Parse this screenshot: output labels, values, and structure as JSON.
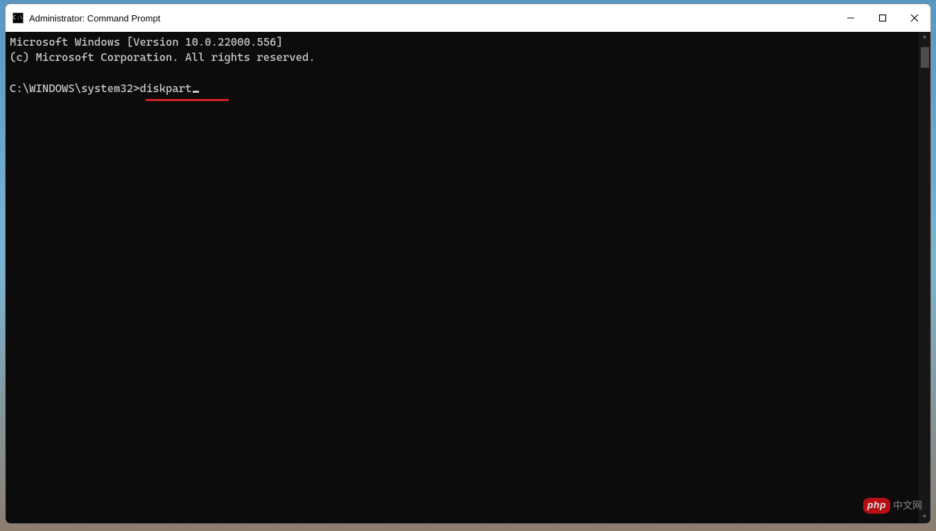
{
  "window": {
    "title": "Administrator: Command Prompt",
    "icon_label": "cmd-icon"
  },
  "controls": {
    "minimize_label": "Minimize",
    "maximize_label": "Maximize",
    "close_label": "Close"
  },
  "console": {
    "line1": "Microsoft Windows [Version 10.0.22000.556]",
    "line2": "(c) Microsoft Corporation. All rights reserved.",
    "blank": "",
    "prompt": "C:\\WINDOWS\\system32>",
    "command": "diskpart"
  },
  "annotation": {
    "underline_color": "#d82324"
  },
  "watermark": {
    "badge": "php",
    "text": "中文网"
  }
}
